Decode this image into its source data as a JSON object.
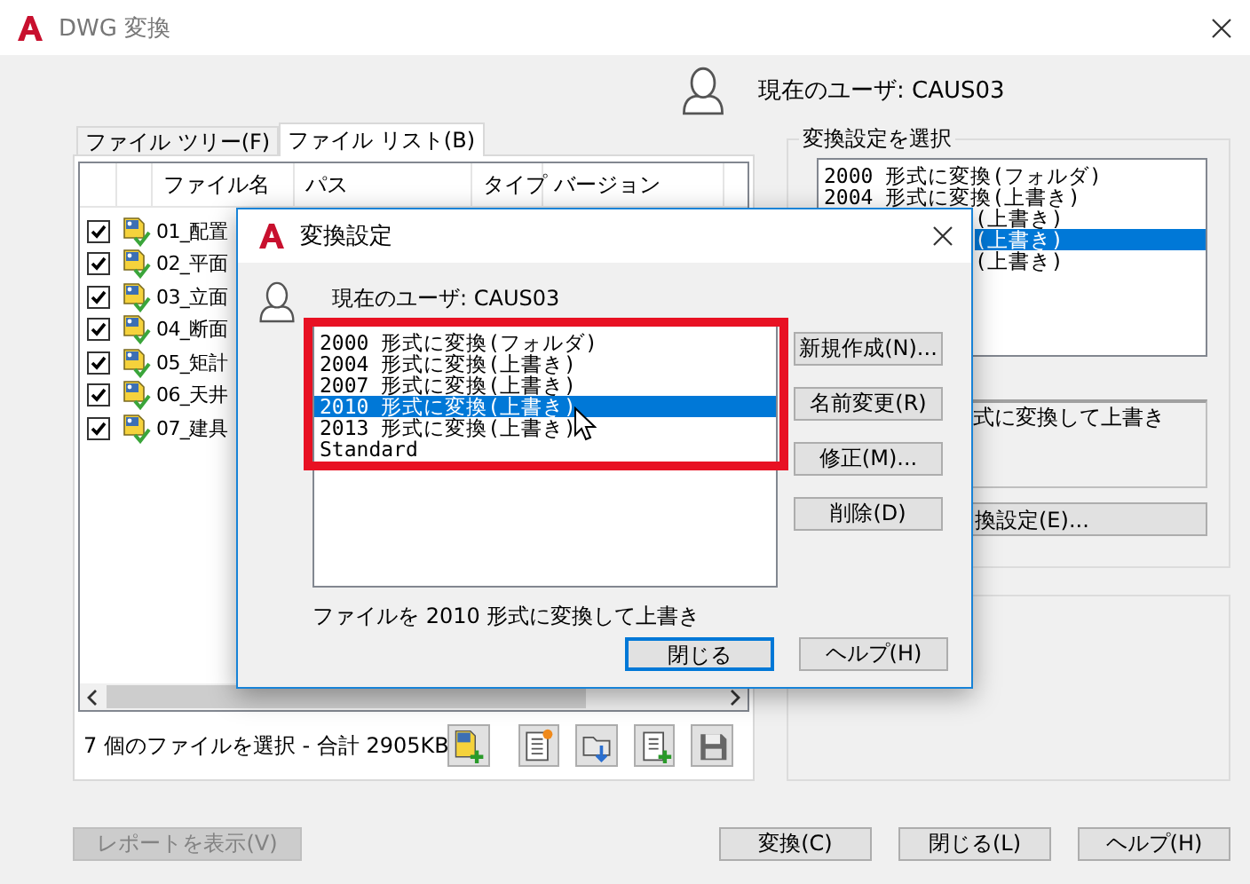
{
  "window": {
    "title": "DWG 変換"
  },
  "current_user": "現在のユーザ: CAUS03",
  "tabs": [
    {
      "label": "ファイル ツリー(F)",
      "selected": false
    },
    {
      "label": "ファイル リスト(B)",
      "selected": true
    }
  ],
  "file_table": {
    "columns": [
      "ファイル名",
      "パス",
      "タイプ",
      "バージョン"
    ],
    "rows": [
      {
        "checked": true,
        "name": "01_配置"
      },
      {
        "checked": true,
        "name": "02_平面"
      },
      {
        "checked": true,
        "name": "03_立面"
      },
      {
        "checked": true,
        "name": "04_断面"
      },
      {
        "checked": true,
        "name": "05_矩計"
      },
      {
        "checked": true,
        "name": "06_天井"
      },
      {
        "checked": true,
        "name": "07_建具"
      }
    ]
  },
  "status": "7 個のファイルを選択 - 合計 2905KB",
  "settings_group": {
    "title": "変換設定を選択",
    "items": [
      {
        "label": "2000 形式に変換(フォルダ)",
        "selected": false,
        "covered": false
      },
      {
        "label": "2004 形式に変換(上書き)",
        "selected": false,
        "covered": false
      },
      {
        "label": "(上書き)",
        "selected": false,
        "covered": true
      },
      {
        "label": "(上書き)",
        "selected": true,
        "covered": true
      },
      {
        "label": "(上書き)",
        "selected": false,
        "covered": true
      }
    ],
    "description": "式に変換して上書き",
    "edit_button": "換設定(E)..."
  },
  "buttons": [
    {
      "label": "レポートを表示(V)",
      "disabled": true
    },
    {
      "label": "変換(C)",
      "disabled": false
    },
    {
      "label": "閉じる(L)",
      "disabled": false
    },
    {
      "label": "ヘルプ(H)",
      "disabled": false
    }
  ],
  "dialog": {
    "title": "変換設定",
    "current_user": "現在のユーザ: CAUS03",
    "items": [
      {
        "label": "2000 形式に変換(フォルダ)",
        "selected": false
      },
      {
        "label": "2004 形式に変換(上書き)",
        "selected": false
      },
      {
        "label": "2007 形式に変換(上書き)",
        "selected": false
      },
      {
        "label": "2010 形式に変換(上書き)",
        "selected": true
      },
      {
        "label": "2013 形式に変換(上書き)",
        "selected": false
      },
      {
        "label": "Standard",
        "selected": false
      }
    ],
    "side_buttons": [
      "新規作成(N)...",
      "名前変更(R)",
      "修正(M)...",
      "削除(D)"
    ],
    "description": "ファイルを 2010 形式に変換して上書き",
    "buttons": [
      {
        "label": "閉じる",
        "default": true
      },
      {
        "label": "ヘルプ(H)",
        "default": false
      }
    ]
  }
}
